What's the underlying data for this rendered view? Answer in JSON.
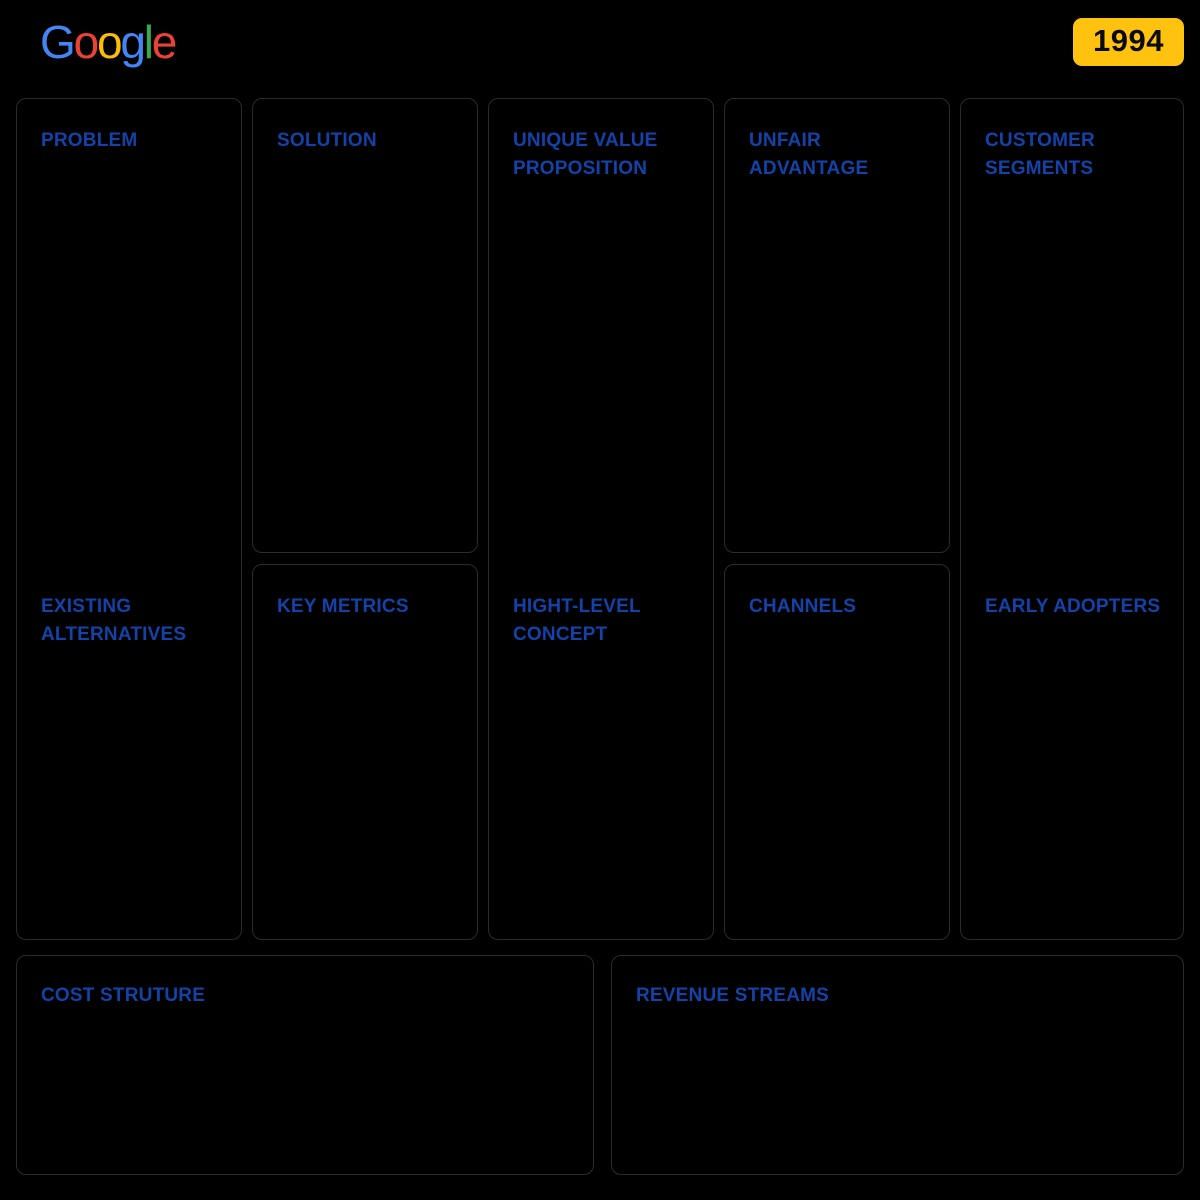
{
  "header": {
    "logo": {
      "name": "google-logo",
      "letters": [
        {
          "char": "G",
          "color": "#4285F4"
        },
        {
          "char": "o",
          "color": "#EA4335"
        },
        {
          "char": "o",
          "color": "#FBBC05"
        },
        {
          "char": "g",
          "color": "#4285F4"
        },
        {
          "char": "l",
          "color": "#34A853"
        },
        {
          "char": "e",
          "color": "#EA4335"
        }
      ],
      "text": "Google"
    },
    "year_badge": {
      "label": "1994",
      "background": "#FFC20E",
      "text_color": "#0A0A0A"
    }
  },
  "theme": {
    "background": "#000000",
    "card_border": "#2B2B2B",
    "label_color": "#1342A8"
  },
  "canvas": {
    "type": "lean-canvas",
    "cards": {
      "problem": {
        "label": "PROBLEM",
        "content": ""
      },
      "existing_alternatives": {
        "label": "EXISTING\nALTERNATIVES",
        "content": ""
      },
      "solution": {
        "label": "SOLUTION",
        "content": ""
      },
      "key_metrics": {
        "label": "KEY METRICS",
        "content": ""
      },
      "unique_value_proposition": {
        "label": "UNIQUE VALUE\nPROPOSITION",
        "content": ""
      },
      "high_level_concept": {
        "label": "HIGHT-LEVEL\nCONCEPT",
        "content": ""
      },
      "unfair_advantage": {
        "label": "UNFAIR\nADVANTAGE",
        "content": ""
      },
      "channels": {
        "label": "CHANNELS",
        "content": ""
      },
      "customer_segments": {
        "label": "CUSTOMER\nSEGMENTS",
        "content": ""
      },
      "early_adopters": {
        "label": "EARLY ADOPTERS",
        "content": ""
      },
      "cost_structure": {
        "label": "COST STRUTURE",
        "content": ""
      },
      "revenue_streams": {
        "label": "REVENUE STREAMS",
        "content": ""
      }
    }
  }
}
